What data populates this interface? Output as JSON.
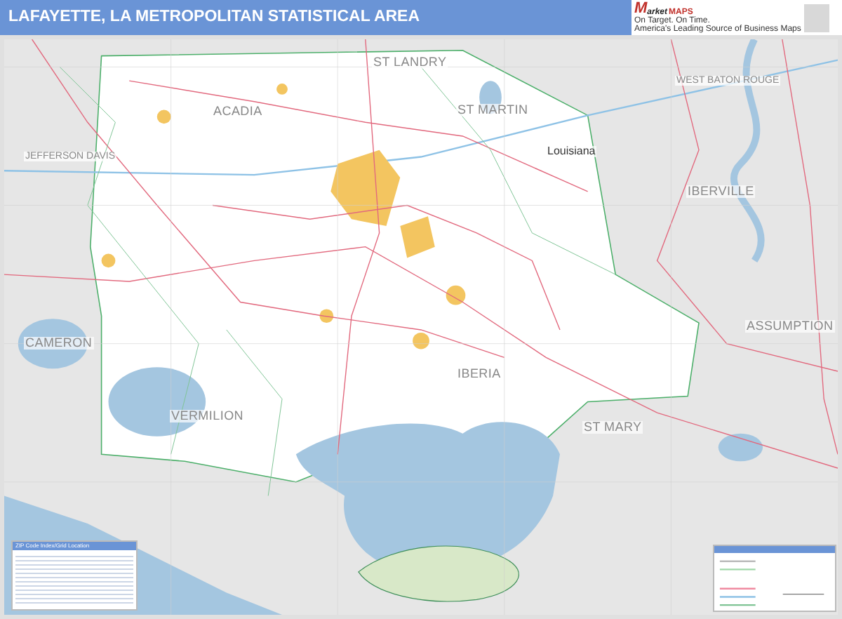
{
  "title": "LAFAYETTE, LA METROPOLITAN STATISTICAL AREA",
  "logo": {
    "initial": "M",
    "brand": "arket",
    "brand_second": "MAPS",
    "tagline": "On Target. On Time.",
    "subtitle": "America's Leading Source of Business Maps"
  },
  "map": {
    "labels": [
      {
        "text": "ST LANDRY",
        "kind": "parish"
      },
      {
        "text": "ACADIA",
        "kind": "parish"
      },
      {
        "text": "ST MARTIN",
        "kind": "parish"
      },
      {
        "text": "Louisiana",
        "kind": "state"
      },
      {
        "text": "WEST BATON ROUGE",
        "kind": "outer"
      },
      {
        "text": "JEFFERSON DAVIS",
        "kind": "outer"
      },
      {
        "text": "IBERVILLE",
        "kind": "parish"
      },
      {
        "text": "CAMERON",
        "kind": "parish"
      },
      {
        "text": "VERMILION",
        "kind": "parish"
      },
      {
        "text": "IBERIA",
        "kind": "parish"
      },
      {
        "text": "ST MARY",
        "kind": "parish"
      },
      {
        "text": "ASSUMPTION",
        "kind": "parish"
      }
    ]
  },
  "zip_index": {
    "title": "ZIP Code Index/Grid Location"
  }
}
